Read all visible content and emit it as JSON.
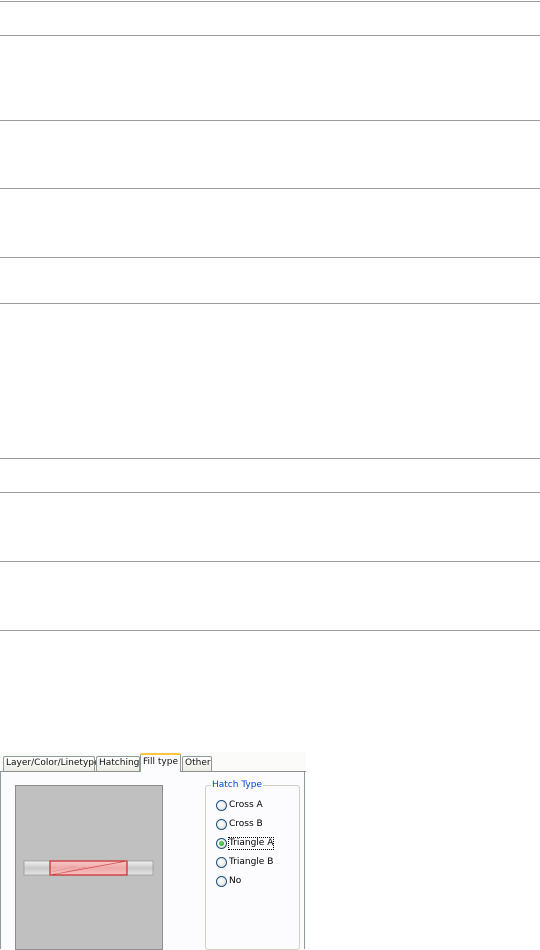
{
  "tabs": [
    {
      "label": "Layer/Color/Linetype",
      "active": false
    },
    {
      "label": "Hatching",
      "active": false
    },
    {
      "label": "Fill type",
      "active": true
    },
    {
      "label": "Other",
      "active": false
    }
  ],
  "hatch_type": {
    "legend": "Hatch Type",
    "options": [
      {
        "label": "Cross A",
        "selected": false
      },
      {
        "label": "Cross B",
        "selected": false
      },
      {
        "label": "Triangle A",
        "selected": true
      },
      {
        "label": "Triangle B",
        "selected": false
      },
      {
        "label": "No",
        "selected": false
      }
    ]
  },
  "colors": {
    "accent_tab": "#ffc83c",
    "legend_text": "#0046d5",
    "preview_bg": "#c0c0c0",
    "fill_red": "#f4b4b4",
    "outline_red": "#c82828",
    "radio_selected": "#21a121"
  }
}
